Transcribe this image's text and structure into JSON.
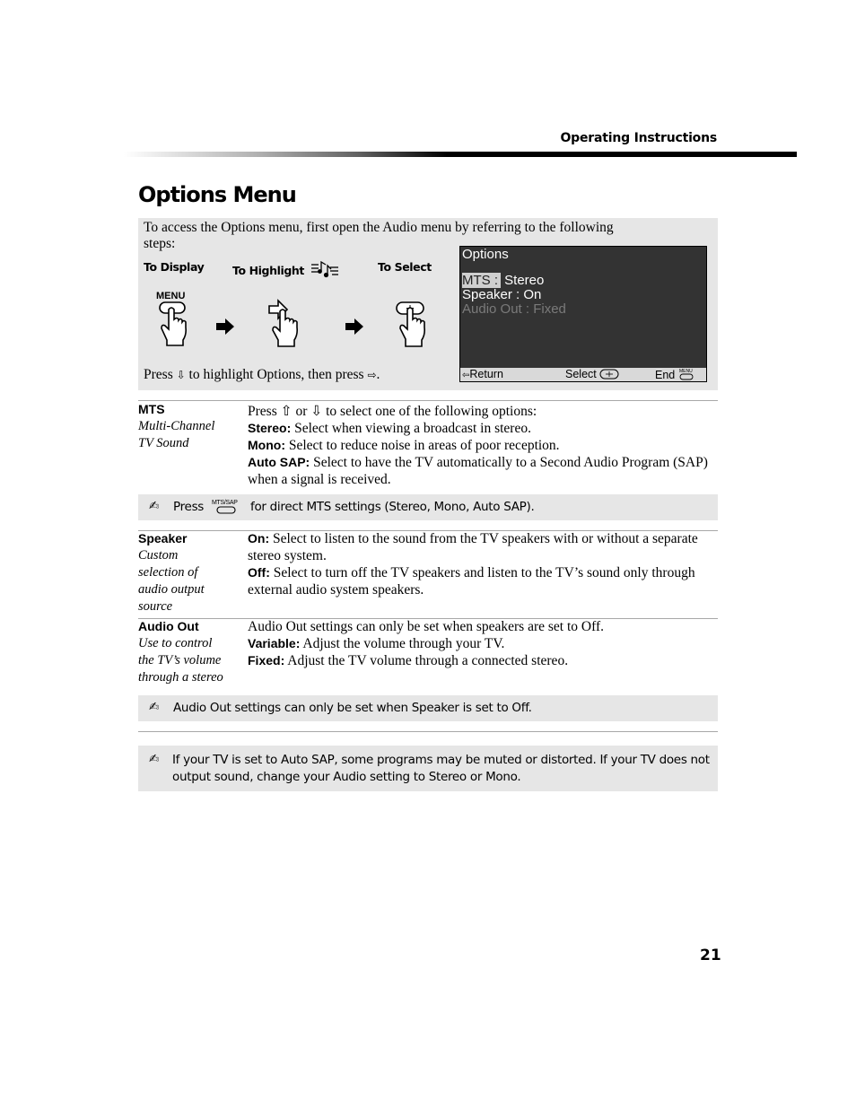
{
  "header": {
    "running_head": "Operating Instructions",
    "title": "Options Menu"
  },
  "access_box": {
    "intro": "To access the Options menu, first open the Audio menu by referring to the following steps:",
    "steps": [
      {
        "label": "To Display",
        "button_label": "MENU",
        "icon": "hand-press-menu-icon"
      },
      {
        "label": "To Highlight",
        "icon": "hand-press-arrow-icon",
        "label_icon": "audio-menu-icon"
      },
      {
        "label": "To Select",
        "icon": "hand-press-select-icon"
      }
    ],
    "press_prefix": "Press",
    "down_arrow": "⇩",
    "press_middle": "to highlight Options, then press",
    "right_arrow": "⇨",
    "press_suffix": "."
  },
  "tv_screen": {
    "title": "Options",
    "items": [
      {
        "label": "MTS :",
        "value": "Stereo",
        "state": "highlighted"
      },
      {
        "label": "Speaker : On",
        "state": "normal"
      },
      {
        "label": "Audio Out : Fixed",
        "state": "disabled"
      }
    ],
    "footer": {
      "return_label": "Return",
      "select_label": "Select",
      "end_label": "End",
      "menu_mini": "MENU"
    }
  },
  "sections": [
    {
      "term": "MTS",
      "desc_lines": [
        "Multi-Channel",
        "TV Sound"
      ],
      "intro": "Press ⇧ or ⇩ to select one of the following options:",
      "options": [
        {
          "name": "Stereo:",
          "text": "Select when viewing a broadcast in stereo."
        },
        {
          "name": "Mono:",
          "text": "Select to reduce noise in areas of poor reception."
        },
        {
          "name": "Auto SAP:",
          "text": "Select to have the TV automatically to a Second Audio Program (SAP) when a signal is received."
        }
      ]
    },
    {
      "term": "Speaker",
      "desc_lines": [
        "Custom",
        "selection of",
        "audio output",
        "source"
      ],
      "intro": "",
      "options": [
        {
          "name": "On:",
          "text": "Select to listen to the sound from the TV speakers with or without a separate stereo system."
        },
        {
          "name": "Off:",
          "text": "Select to turn off the TV speakers and listen to the TV’s sound only through external audio system speakers."
        }
      ]
    },
    {
      "term": "Audio Out",
      "desc_lines": [
        "Use to control",
        "the TV’s volume",
        "through a stereo"
      ],
      "intro": "Audio Out settings can only be set when speakers are set to Off.",
      "options": [
        {
          "name": "Variable:",
          "text": "Adjust the volume through your TV."
        },
        {
          "name": "Fixed:",
          "text": "Adjust the TV volume through a connected stereo."
        }
      ]
    }
  ],
  "notes": {
    "mts": {
      "prefix": "Press",
      "button_label": "MTS/SAP",
      "text": "for direct MTS settings (Stereo, Mono, Auto SAP)."
    },
    "audio_out": "Audio Out settings can only be set when Speaker is set to Off.",
    "auto_sap": "If your TV is set to Auto SAP, some programs may be muted or distorted. If your TV does not output sound, change your Audio setting to Stereo or Mono."
  },
  "page_number": "21"
}
